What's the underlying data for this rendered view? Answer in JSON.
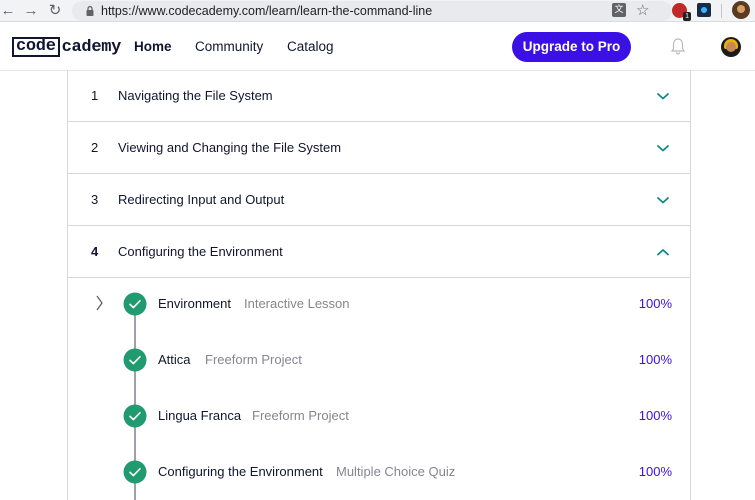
{
  "browser": {
    "url": "https://www.codecademy.com/learn/learn-the-command-line",
    "extension_badge": "1"
  },
  "header": {
    "logo_prefix": "code",
    "logo_suffix": "cademy",
    "nav": [
      "Home",
      "Community",
      "Catalog"
    ],
    "upgrade_label": "Upgrade to Pro"
  },
  "modules": [
    {
      "number": "1",
      "title": "Navigating the File System",
      "expanded": false
    },
    {
      "number": "2",
      "title": "Viewing and Changing the File System",
      "expanded": false
    },
    {
      "number": "3",
      "title": "Redirecting Input and Output",
      "expanded": false
    },
    {
      "number": "4",
      "title": "Configuring the Environment",
      "expanded": true
    }
  ],
  "lessons": [
    {
      "title": "Environment",
      "type": "Interactive Lesson",
      "progress": "100%"
    },
    {
      "title": "Attica",
      "type": "Freeform Project",
      "progress": "100%"
    },
    {
      "title": "Lingua Franca",
      "type": "Freeform Project",
      "progress": "100%"
    },
    {
      "title": "Configuring the Environment",
      "type": "Multiple Choice Quiz",
      "progress": "100%"
    }
  ],
  "colors": {
    "accent": "#3a10e5",
    "complete_green": "#1f9b6f",
    "chevron_teal": "#0b8a8a"
  },
  "icons": [
    "back-icon",
    "forward-icon",
    "reload-icon",
    "lock-icon",
    "translate-icon",
    "star-icon",
    "bell-icon",
    "check-icon",
    "chevron-down-icon",
    "chevron-up-icon",
    "chevron-right-icon"
  ]
}
